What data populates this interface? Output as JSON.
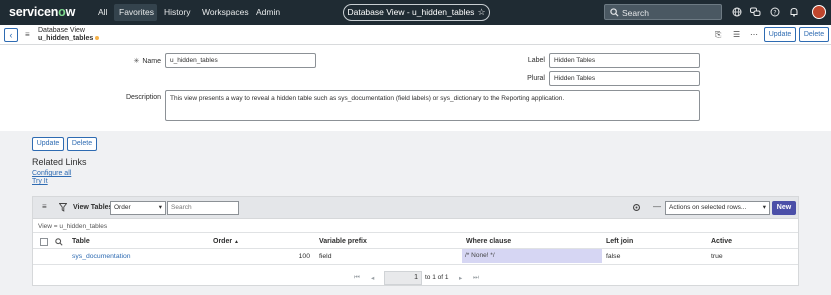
{
  "nav": {
    "logo_text": "servicen",
    "logo_o": "o",
    "logo_tail": "w",
    "items": [
      "All",
      "Favorites",
      "History",
      "Workspaces",
      "Admin"
    ],
    "context_pill": "Database View - u_hidden_tables",
    "search_placeholder": "Search",
    "icons": [
      "globe-icon",
      "chat-icon",
      "help-icon",
      "bell-icon",
      "avatar"
    ]
  },
  "header": {
    "record_type": "Database View",
    "record_name": "u_hidden_tables",
    "update_label": "Update",
    "delete_label": "Delete"
  },
  "form": {
    "name_label": "Name",
    "name_value": "u_hidden_tables",
    "label_label": "Label",
    "label_value": "Hidden Tables",
    "plural_label": "Plural",
    "plural_value": "Hidden Tables",
    "description_label": "Description",
    "description_value": "This view presents a way to reveal a hidden table such as sys_documentation (field labels) or sys_dictionary to the Reporting application."
  },
  "buttons": {
    "update": "Update",
    "delete": "Delete"
  },
  "related_links": {
    "title": "Related Links",
    "links": [
      "Configure all",
      "Try It"
    ]
  },
  "related_list": {
    "title": "View Tables",
    "filter_select": "Order",
    "search_placeholder": "Search",
    "actions_select": "Actions on selected rows...",
    "new_label": "New",
    "breadcrumb": "View = u_hidden_tables",
    "columns": [
      "Table",
      "Order",
      "Variable prefix",
      "Where clause",
      "Left join",
      "Active"
    ],
    "sort_indicator": "▲",
    "rows": [
      {
        "table": "sys_documentation",
        "order": "100",
        "prefix": "field",
        "where": "/* None! */",
        "left_join": "false",
        "active": "true"
      }
    ],
    "pager": {
      "page": "1",
      "of_text": "to 1 of 1"
    }
  }
}
